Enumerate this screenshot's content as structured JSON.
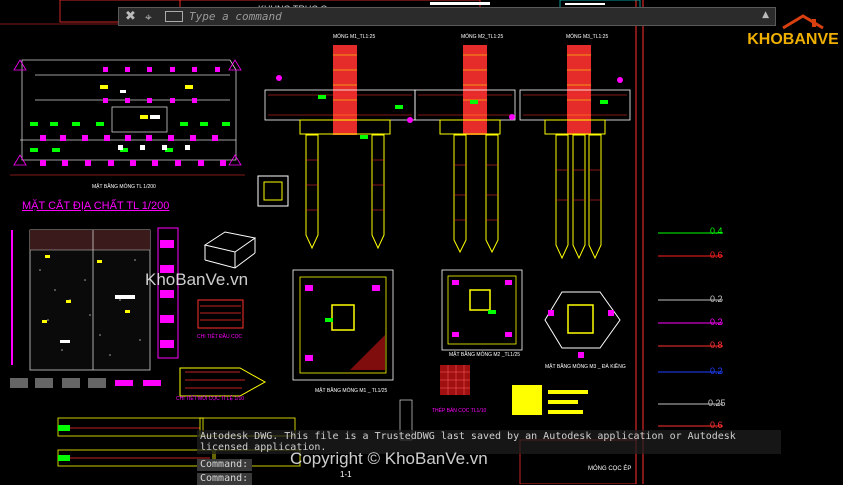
{
  "command_bar": {
    "placeholder": "Type a command",
    "close_glyph": "✖",
    "icon_glyph": "⌖",
    "dropdown_glyph": "▲"
  },
  "drawing": {
    "frame_title": "KHUNG TRỤC G",
    "column_titles": [
      "MÓNG M1_TL1:25",
      "MÓNG M2_TL1:25",
      "MÓNG M3_TL1:25"
    ],
    "site_plan_caption": "MẶT BẰNG MÓNG TL 1/200",
    "geology_title": "MẶT CẮT ĐỊA CHẤT TL 1/200",
    "pile_cap_caption": "CHI TIẾT ĐẦU CỌC",
    "pile_tip_caption": "CHI TIẾT MŨI CỌC TỈ LỆ 1/10",
    "plan_m1_caption": "MẶT BẰNG MÓNG M1 _ TL1/25",
    "plan_m2_caption": "MẶT BẰNG MÓNG M2 _TL1/25",
    "plan_m3_caption": "MẶT BẰNG MÓNG M3 _ ĐÀ KIỀNG",
    "steel_plate_caption": "THÉP BẢN CỌC TL1/10",
    "pile_section_caption": "MÓNG CỌC ÉP",
    "section_label": "1-1"
  },
  "legend": {
    "items": [
      {
        "label": "0.4",
        "color": "#00ff00"
      },
      {
        "label": "0.6",
        "color": "#ff2020"
      },
      {
        "label": "0.2",
        "color": "#c0c0c0"
      },
      {
        "label": "0.2",
        "color": "#ff00ff"
      },
      {
        "label": "0.8",
        "color": "#ff3030"
      },
      {
        "label": "0.2",
        "color": "#2040ff"
      },
      {
        "label": "0.25",
        "color": "#c0c0c0"
      },
      {
        "label": "0.6",
        "color": "#ff3030"
      }
    ]
  },
  "watermarks": {
    "logo": "KHOBANVE",
    "center": "KhoBanVe.vn",
    "copyright": "Copyright © KhoBanVe.vn"
  },
  "command_history": {
    "message": "Autodesk DWG. This file is a TrustedDWG last saved by an Autodesk application or Autodesk licensed application.",
    "prompts": [
      "Command:",
      "Command:"
    ]
  }
}
